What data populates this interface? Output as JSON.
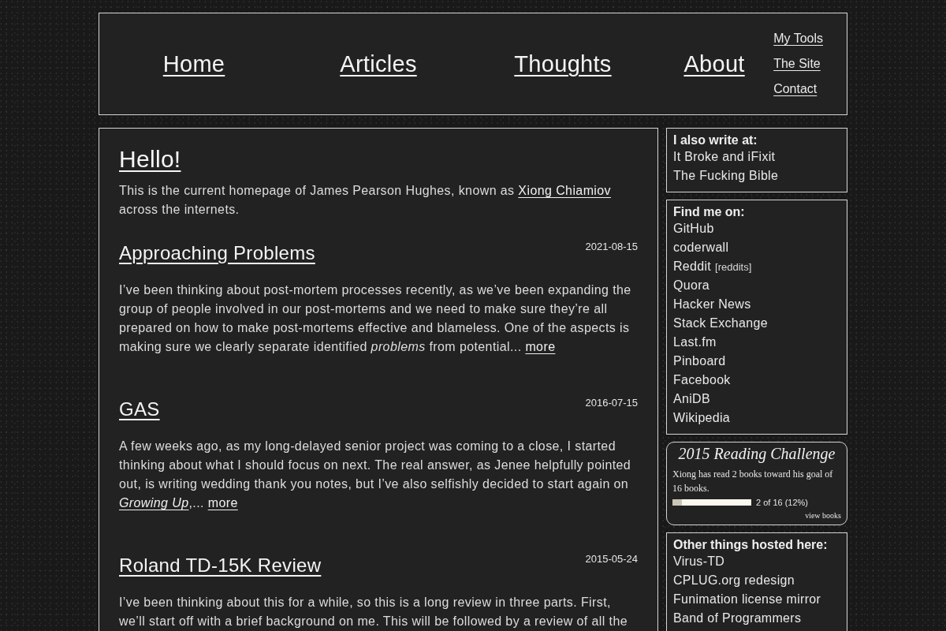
{
  "header": {
    "nav": [
      "Home",
      "Articles",
      "Thoughts",
      "About"
    ],
    "side_links": [
      "My Tools",
      "The Site",
      "Contact"
    ]
  },
  "main": {
    "heading": "Hello!",
    "intro": [
      {
        "kind": "text",
        "text": "This is the current homepage of James Pearson Hughes, known as"
      },
      {
        "kind": "link",
        "text": "Xiong Chiamiov"
      },
      {
        "kind": "text",
        "text": "across the internets."
      }
    ],
    "articles": [
      {
        "title": "Approaching Problems",
        "date": "2021-08-15",
        "excerpt": [
          {
            "kind": "text",
            "text": "I’ve been thinking about post-mortem processes recently, as we’ve been expanding the group of people involved in our post-mortems and we need to make sure they’re all prepared on how to make post-mortems effective and blameless. One of the aspects is making sure we clearly separate identified *problems* from potential..."
          },
          {
            "kind": "more",
            "text": "more"
          }
        ]
      },
      {
        "title": "GAS",
        "date": "2016-07-15",
        "excerpt": [
          {
            "kind": "text",
            "text": "A few weeks ago, as my long-delayed senior project was coming to a close, I started thinking about what I should focus on next. The real answer, as Jenee helpfully pointed out, is writing wedding thank you notes, but I’ve also selfishly decided to start again on"
          },
          {
            "kind": "link",
            "text": "Growing Up",
            "italic": true,
            "after": ",..."
          },
          {
            "kind": "more",
            "text": "more"
          }
        ]
      },
      {
        "title": "Roland TD-15K Review",
        "date": "2015-05-24",
        "excerpt": [
          {
            "kind": "text",
            "text": "I’ve been thinking about this for a while, so this is a long review in three parts. First, we’ll start off with a brief background on me. This will be followed by a review of all the"
          }
        ]
      }
    ]
  },
  "sidebar": {
    "panels": [
      {
        "kind": "list",
        "heading": "I also write at:",
        "items": [
          {
            "label": "It Broke and iFixit"
          },
          {
            "label": "The Fucking Bible"
          }
        ]
      },
      {
        "kind": "list",
        "heading": "Find me on:",
        "items": [
          {
            "label": "GitHub"
          },
          {
            "label": "coderwall"
          },
          {
            "label": "Reddit",
            "extra": "[reddits]"
          },
          {
            "label": "Quora"
          },
          {
            "label": "Hacker News"
          },
          {
            "label": "Stack Exchange"
          },
          {
            "label": "Last.fm"
          },
          {
            "label": "Pinboard"
          },
          {
            "label": "Facebook"
          },
          {
            "label": "AniDB"
          },
          {
            "label": "Wikipedia"
          }
        ]
      },
      {
        "kind": "reading",
        "title": "2015 Reading Challenge",
        "text": "Xiong has read 2 books toward his goal of 16 books.",
        "level": 0.12,
        "reading": "2 of 16 (12%)",
        "link": "view books"
      },
      {
        "kind": "list",
        "heading": "Other things hosted here:",
        "items": [
          {
            "label": "Virus-TD"
          },
          {
            "label": "CPLUG.org redesign"
          },
          {
            "label": "Funimation license mirror"
          },
          {
            "label": "Band of Programmers"
          }
        ]
      }
    ]
  }
}
